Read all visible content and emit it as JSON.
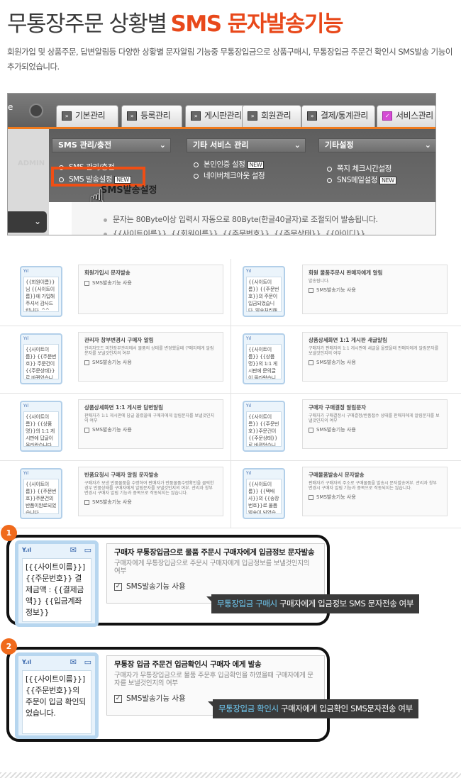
{
  "header": {
    "title_part1": "무통장주문 상황별",
    "title_part2": "SMS 문자발송기능",
    "description": "회원가입 및 상품주문, 답변알림등 다양한 상황별 문자알림 기능중 무통장입금으로 상품구매시, 무통장입금 주문건 확인시 SMS발송 기능이 추가되었습니다."
  },
  "admin_screenshot": {
    "tabs": [
      {
        "label": "기본관리",
        "icon": "menu-icon"
      },
      {
        "label": "등록관리",
        "icon": "menu-icon"
      },
      {
        "label": "게시판관리",
        "icon": "menu-icon"
      },
      {
        "label": "회원관리",
        "icon": "menu-icon"
      },
      {
        "label": "결제/통계관리",
        "icon": "menu-icon"
      },
      {
        "label": "서비스관리",
        "icon": "check-icon"
      }
    ],
    "groups": [
      {
        "label": "SMS 관리/충전"
      },
      {
        "label": "기타 서비스 관리"
      },
      {
        "label": "기타설정"
      }
    ],
    "menu": {
      "sms_manage": "SMS 관리/충전",
      "sms_send_settings": "SMS 발송설정",
      "identity_settings": "본인인증 설정",
      "naver_checkout": "네이버체크아웃 설정",
      "note_check": "쪽지 체크시간설정",
      "sns_mail": "SNS메일설정"
    },
    "new_badge": "NEW",
    "admin_label": "ADMIN",
    "highlight_ghost": "SMS발송설정",
    "lower_line1": "문자는 80Byte이상 입력시 자동으로 80Byte(한글40글자)로 조절되어 발송됩니다.",
    "lower_line2": "{{사이트이름}}, {{회원이름}}, {{주문번호}}, {{주문상태}}, {{아이디}}"
  },
  "grid_cards": [
    {
      "title": "회원가입시 문자발송",
      "desc": "",
      "check": "SMS발송기능 사용",
      "sms": "{{회원이름}}님 {{사이트이름}}에 가입해주셔서 감사드립니다. ^^"
    },
    {
      "title": "회원 물품주문시 판매자에게 알림",
      "desc": "발송됩니다.",
      "check": "SMS발송기능 사용",
      "sms": "{{사이트이름}} {{주문번호}}의 주문이 입금되었습니다. 발송처리해주세요 ^^"
    },
    {
      "title": "관리자 창부변경시 구매자 알림",
      "desc": "관리자모드 미찬장부관리에서 물품의 상태를 변경했을때 구매자에게 알림문자를 보낼것인지의 여부",
      "check": "SMS발송기능 사용",
      "sms": "{{사이트이름}} {{주문번호}} 주문건이 {{주문상태}}로 바뀌었습니다"
    },
    {
      "title": "상품상세화면 1:1 게시판 새글알림",
      "desc": "구매자가 판매자의 1:1 게시판에 새글을 올렸을때 판매자에게 알림문자를 보낼것인지의 여부",
      "check": "SMS발송기능 사용",
      "sms": "{{사이트이름}} {{상품명}}의 1:1 게시판에 문의글이 올라왔습니다. ^^"
    },
    {
      "title": "상품상세화면 1:1 게시판 답변알림",
      "desc": "판매자가 1:1 게시판에 답글 올렸을때 구매자에게 알림문자를 보낼것인지의 여부",
      "check": "SMS발송기능 사용",
      "sms": "{{사이트이름}} {{상품명}}의 1:1 게시판에 답글이 올라왔습니다. ^^"
    },
    {
      "title": "구매자 구매결정 알림문자",
      "desc": "구매자가 구매결정시 구매결정/반품접수 상태를 판매자에게 알림문자를 보낼것인지의 여부",
      "check": "SMS발송기능 사용",
      "sms": "{{사이트이름}} {{주문번호}}주문건이 {{주문상태}}로 바뀌었습니다."
    },
    {
      "title": "반품요청시 구매자 알림 문자발송",
      "desc": "구매자가 보낸 반품물품을 수령하여 판매자가 반품물품수령확인을 클릭한 경우 반품상태를 구매자에게 알림문자를 보낼것인지의 여부. 관리자 창부 변경시 구매자 알림 기능과 중복으로 작동되지는 않습니다.",
      "check": "SMS발송기능 사용",
      "sms": "{{사이트이름}} {{주문번호}}주문건의 반품이완료되었습니다."
    },
    {
      "title": "구매물품발송시 문자발송",
      "desc": "판매자가 구매자의 주소로 구매물품을 발송시 문자발송여부. 관리자 창부 변경시 구매자 알림 기능과 중복으로 작동되지는 않습니다.",
      "check": "SMS발송기능 사용",
      "sms": "{{사이트이름}} {{택배사}}의 {{송장번호}}로 물품발송이 되었습니다. ^^"
    }
  ],
  "details": [
    {
      "number": "1",
      "title": "구매자 무통장입금으로 물품 주문시 구매자에게 입금정보 문자발송",
      "desc": "구매자에게 무통장입금으로 주문시 구매자에게 입금정보를 보낼것인지의 여부",
      "check": "SMS발송기능 사용",
      "sms": "[{{사이트이름}}] {{주문번호}} 결제금액 : {{결제금액}} {{입금계좌정보}}",
      "tip_highlight": "무통장입금 구매시",
      "tip_rest": " 구매자에게 입금정보 SMS 문자전송 여부"
    },
    {
      "number": "2",
      "title": "무통장 입금 주문건 입금확인시 구매자 에게 발송",
      "desc": "구매자가 무통장입금으로 물품 주문후 입금확인을 하였을때 구매자에게 문자를 보낼것인지의 여부",
      "check": "SMS발송기능 사용",
      "sms": "[{{사이트이름}}] {{주문번호}}의 주문이 입금 확인되었습니다.",
      "tip_highlight": "무통장입금 확인시",
      "tip_rest": " 구매자에게 입금확인 SMS문자전송 여부"
    }
  ],
  "phone_icons": {
    "signal": "signal-icon",
    "envelope": "envelope-icon",
    "battery": "battery-icon"
  },
  "colors": {
    "accent_orange": "#e8481a",
    "highlight_blue": "#6fc8f0"
  }
}
